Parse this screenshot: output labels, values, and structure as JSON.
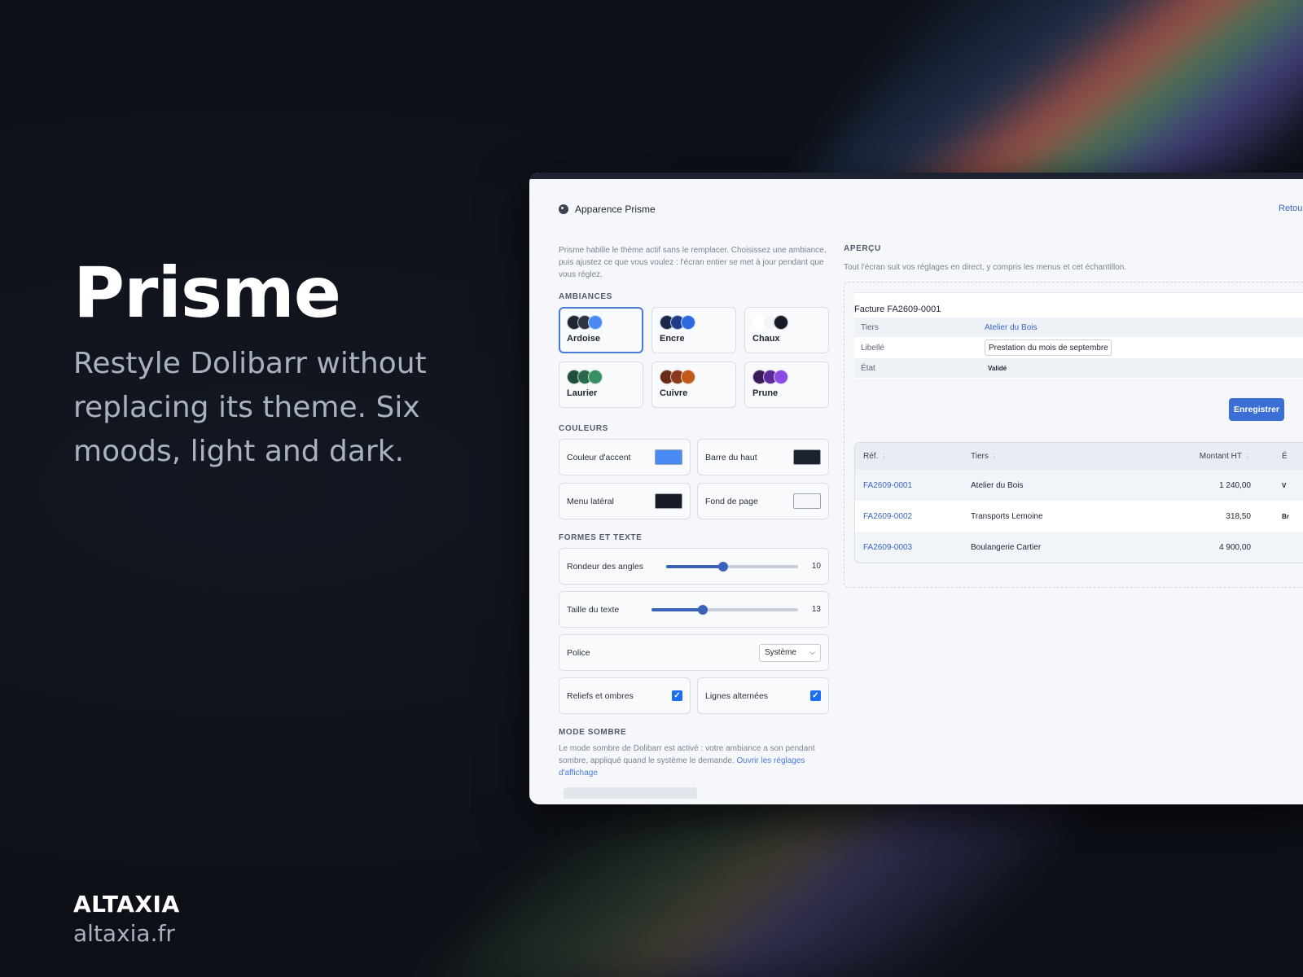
{
  "hero": {
    "title": "Prisme",
    "subtitle": "Restyle Dolibarr without replacing its theme. Six moods, light and dark."
  },
  "brand": {
    "name": "ALTAXIA",
    "url": "altaxia.fr"
  },
  "app": {
    "page_title": "Apparence Prisme",
    "back_link": "Retour",
    "intro": "Prisme habille le thème actif sans le remplacer. Choisissez une ambiance, puis ajustez ce que vous voulez : l'écran entier se met à jour pendant que vous réglez.",
    "sections": {
      "moods": "AMBIANCES",
      "colors": "COULEURS",
      "shapes": "FORMES ET TEXTE",
      "dark": "MODE SOMBRE"
    },
    "moods": [
      {
        "name": "Ardoise",
        "dots": [
          "#1e2430",
          "#2c3444",
          "#4a8af4"
        ]
      },
      {
        "name": "Encre",
        "dots": [
          "#1b2a4a",
          "#1f3d8a",
          "#2b6ae0"
        ]
      },
      {
        "name": "Chaux",
        "dots": [
          "#ffffff",
          "#f3f4f6",
          "#161b28"
        ]
      },
      {
        "name": "Laurier",
        "dots": [
          "#1f4d3a",
          "#2a6a4c",
          "#3a8f62"
        ]
      },
      {
        "name": "Cuivre",
        "dots": [
          "#6a2a18",
          "#8a3a1c",
          "#c2591a"
        ]
      },
      {
        "name": "Prune",
        "dots": [
          "#3a1a5a",
          "#5a2a9a",
          "#8a4ae4"
        ]
      }
    ],
    "colors": [
      {
        "label": "Couleur d'accent",
        "value": "#4a8af4"
      },
      {
        "label": "Barre du haut",
        "value": "#1c2230"
      },
      {
        "label": "Menu latéral",
        "value": "#161b26"
      },
      {
        "label": "Fond de page",
        "value": "#f5f7fb"
      }
    ],
    "shapes": {
      "radius_label": "Rondeur des angles",
      "radius_value": "10",
      "radius_fraction": 0.43,
      "text_size_label": "Taille du texte",
      "text_size_value": "13",
      "text_size_fraction": 0.35,
      "font_label": "Police",
      "font_value": "Système",
      "reliefs_label": "Reliefs et ombres",
      "alt_rows_label": "Lignes alternées"
    },
    "dark_note": "Le mode sombre de Dolibarr est activé : votre ambiance a son pendant sombre, appliqué quand le système le demande.",
    "dark_link": "Ouvrir les réglages d'affichage",
    "preview": {
      "title": "APERÇU",
      "subtitle": "Tout l'écran suit vos réglages en direct, y compris les menus et cet échantillon.",
      "invoice_title": "Facture FA2609-0001",
      "fields": [
        {
          "key": "Tiers",
          "value": "Atelier du Bois"
        },
        {
          "key": "Libellé",
          "value": "Prestation du mois de septembre"
        },
        {
          "key": "État",
          "value": "Validé"
        }
      ],
      "save_label": "Enregistrer",
      "table_headers": [
        "Réf.",
        "Tiers",
        "Montant HT",
        "É"
      ],
      "rows": [
        {
          "ref": "FA2609-0001",
          "tiers": "Atelier du Bois",
          "amount": "1 240,00",
          "status": "V"
        },
        {
          "ref": "FA2609-0002",
          "tiers": "Transports Lemoine",
          "amount": "318,50",
          "status": "Br"
        },
        {
          "ref": "FA2609-0003",
          "tiers": "Boulangerie Cartier",
          "amount": "4 900,00",
          "status": ""
        }
      ]
    }
  }
}
